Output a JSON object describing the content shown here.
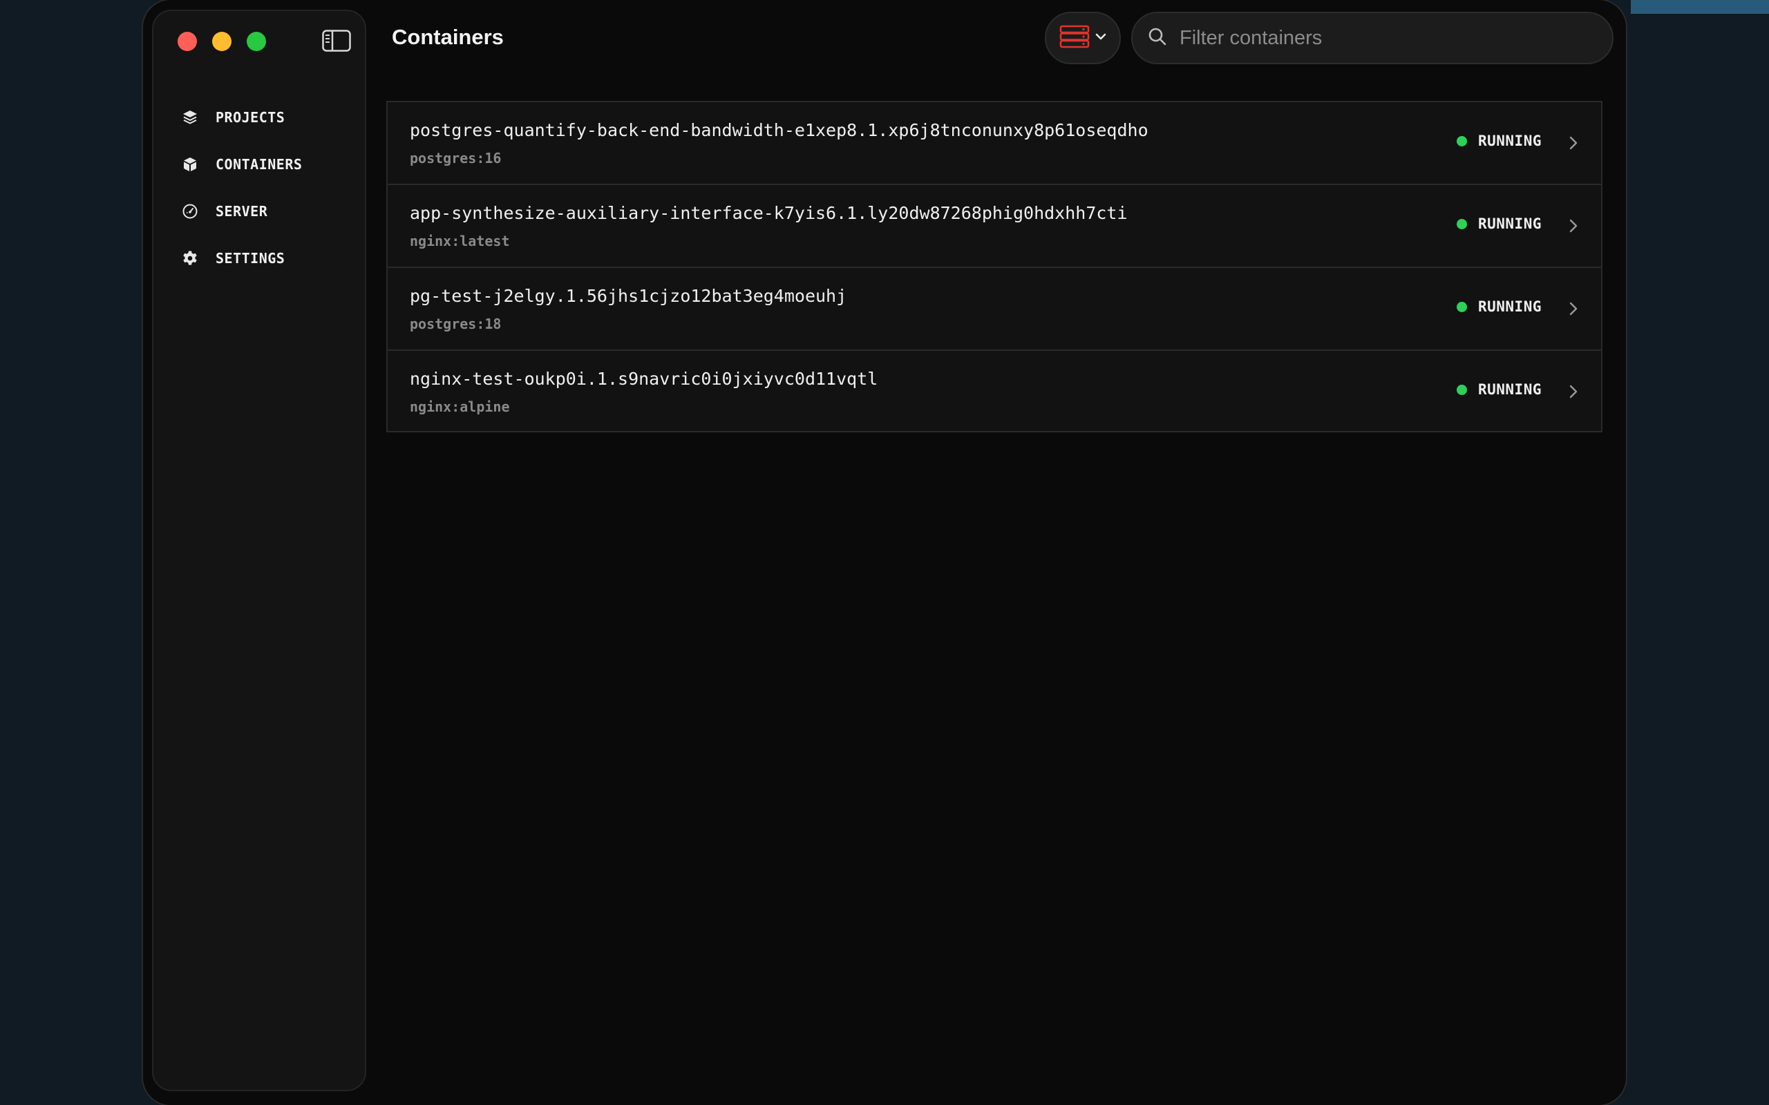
{
  "window": {
    "title": "Containers"
  },
  "sidebar": {
    "items": [
      {
        "label": "PROJECTS",
        "icon": "layers-icon"
      },
      {
        "label": "CONTAINERS",
        "icon": "box-icon"
      },
      {
        "label": "SERVER",
        "icon": "gauge-icon"
      },
      {
        "label": "SETTINGS",
        "icon": "gear-icon"
      }
    ]
  },
  "header": {
    "server_picker_icon": "server-icon",
    "server_picker_color": "#e0352b",
    "search": {
      "placeholder": "Filter containers",
      "value": ""
    }
  },
  "containers": [
    {
      "name": "postgres-quantify-back-end-bandwidth-e1xep8.1.xp6j8tnconunxy8p61oseqdho",
      "image": "postgres:16",
      "status": "RUNNING"
    },
    {
      "name": "app-synthesize-auxiliary-interface-k7yis6.1.ly20dw87268phig0hdxhh7cti",
      "image": "nginx:latest",
      "status": "RUNNING"
    },
    {
      "name": "pg-test-j2elgy.1.56jhs1cjzo12bat3eg4moeuhj",
      "image": "postgres:18",
      "status": "RUNNING"
    },
    {
      "name": "nginx-test-oukp0i.1.s9navric0i0jxiyvc0d11vqtl",
      "image": "nginx:alpine",
      "status": "RUNNING"
    }
  ],
  "colors": {
    "status_running": "#2ed158",
    "background": "#0a0a0a"
  }
}
